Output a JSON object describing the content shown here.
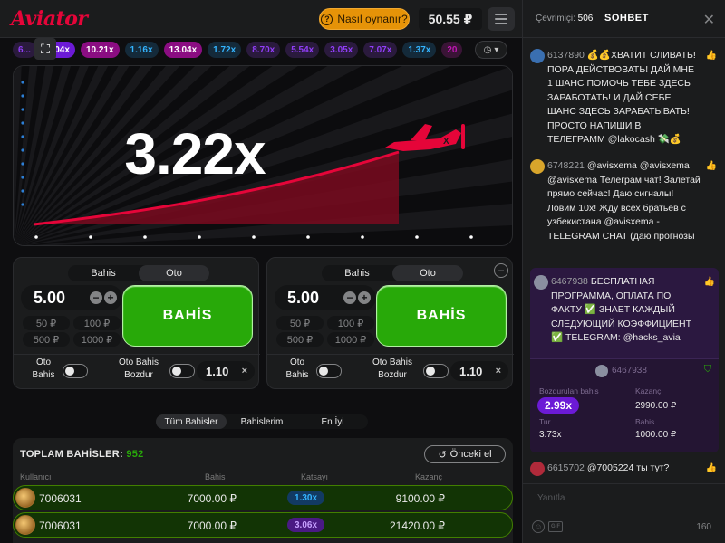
{
  "header": {
    "logo": "Aviator",
    "how_to_play": "Nasıl oynanır?",
    "balance": "50.55 ₽"
  },
  "history": [
    "6...",
    "5.04x",
    "10.21x",
    "1.16x",
    "13.04x",
    "1.72x",
    "8.70x",
    "5.54x",
    "3.05x",
    "7.07x",
    "1.37x",
    "20"
  ],
  "history_styles": [
    "purple",
    "purple-solid",
    "pink-solid",
    "blue",
    "pink-solid",
    "blue",
    "purple",
    "purple",
    "purple",
    "purple",
    "blue",
    "pink"
  ],
  "game": {
    "multiplier": "3.22x"
  },
  "bet_panels": [
    {
      "tabs": [
        "Bahis",
        "Oto"
      ],
      "active_tab": 1,
      "amount": "5.00",
      "quick": [
        "50 ₽",
        "100 ₽",
        "500 ₽",
        "1000 ₽"
      ],
      "bet_label": "BAHİS",
      "auto_bet_label_1": "Oto",
      "auto_bet_label_2": "Bahis",
      "auto_cash_label_1": "Oto Bahis",
      "auto_cash_label_2": "Bozdur",
      "cashout_value": "1.10",
      "x": "×"
    },
    {
      "tabs": [
        "Bahis",
        "Oto"
      ],
      "active_tab": 1,
      "amount": "5.00",
      "quick": [
        "50 ₽",
        "100 ₽",
        "500 ₽",
        "1000 ₽"
      ],
      "bet_label": "BAHİS",
      "auto_bet_label_1": "Oto",
      "auto_bet_label_2": "Bahis",
      "auto_cash_label_1": "Oto Bahis",
      "auto_cash_label_2": "Bozdur",
      "cashout_value": "1.10",
      "x": "×"
    }
  ],
  "bets_tabs": [
    "Tüm Bahisler",
    "Bahislerim",
    "En İyi"
  ],
  "bets": {
    "total_label": "TOPLAM BAHİSLER:",
    "total_count": "952",
    "prev_button": "Önceki el",
    "columns": [
      "Kullanıcı",
      "Bahis",
      "Katsayı",
      "Kazanç"
    ],
    "rows": [
      {
        "user": "7006031",
        "amount": "7000.00 ₽",
        "coef": "1.30x",
        "coef_color": "#34b4ff",
        "win": "9100.00 ₽"
      },
      {
        "user": "7006031",
        "amount": "7000.00 ₽",
        "coef": "3.06x",
        "coef_color": "#913ef8",
        "win": "21420.00 ₽"
      }
    ]
  },
  "chat": {
    "online_label": "Çevrimiçi:",
    "online_count": "506",
    "title": "SOHBET",
    "messages": [
      {
        "id": "6137890",
        "text": "💰💰ХВАТИТ СЛИВАТЬ! ПОРА ДЕЙСТВОВАТЬ! ДАЙ МНЕ 1 ШАНС ПОМОЧЬ ТЕБЕ ЗДЕСЬ ЗАРАБОТАТЬ! И ДАЙ СЕБЕ ШАНС ЗДЕСЬ ЗАРАБАТЫВАТЬ! ПРОСТО НАПИШИ В ТЕЛЕГРАММ @lakocash 💸💰"
      },
      {
        "id": "6748221",
        "text": "@avisxema @avisxema @avisxema Телеграм чат! Залетай прямо сейчас! Даю сигналы! Ловим 10x! Жду всех братьев с узбекистана @avisxema -TELEGRAM CHAT (даю прогнозы"
      },
      {
        "id": "6467938",
        "text": "БЕСПЛАТНАЯ ПРОГРАММА, ОПЛАТА ПО ФАКТУ ✅ ЗНАЕТ КАЖДЫЙ СЛЕДУЮЩИЙ КОЭФФИЦИЕНТ ✅ TELEGRAM: @hacks_avia"
      },
      {
        "id": "6615702",
        "text": "@7005224 ты тут?"
      }
    ],
    "share": {
      "user": "6467938",
      "cashout_label": "Bozdurulan bahis",
      "cashout_value": "2.99x",
      "win_label": "Kazanç",
      "win_value": "2990.00 ₽",
      "round_label": "Tur",
      "round_value": "3.73x",
      "bet_label": "Bahis",
      "bet_value": "1000.00 ₽"
    },
    "input_placeholder": "Yanıtla",
    "char_count": "160"
  }
}
